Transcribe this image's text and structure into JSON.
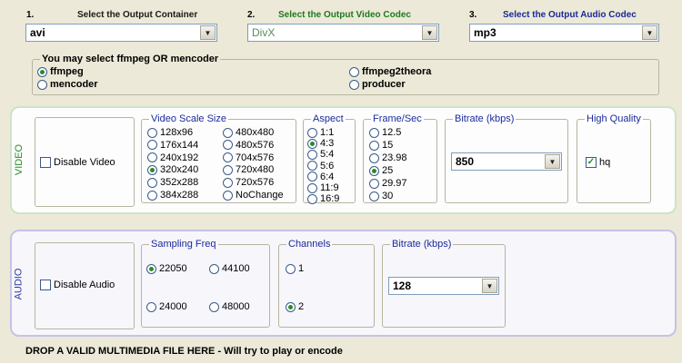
{
  "selectors": [
    {
      "num": "1.",
      "label": "Select the Output Container",
      "value": "avi"
    },
    {
      "num": "2.",
      "label": "Select the Output Video Codec",
      "value": "DivX"
    },
    {
      "num": "3.",
      "label": "Select the Output Audio Codec",
      "value": "mp3"
    }
  ],
  "encoder": {
    "title": "You may select ffmpeg OR mencoder",
    "options": [
      "ffmpeg",
      "mencoder",
      "ffmpeg2theora",
      "producer"
    ],
    "selected": "ffmpeg"
  },
  "video": {
    "panel_label": "VIDEO",
    "disable_label": "Disable Video",
    "scale": {
      "title": "Video Scale Size",
      "options": [
        "128x96",
        "176x144",
        "240x192",
        "320x240",
        "352x288",
        "384x288",
        "480x480",
        "480x576",
        "704x576",
        "720x480",
        "720x576",
        "NoChange"
      ],
      "selected": "320x240"
    },
    "aspect": {
      "title": "Aspect",
      "options": [
        "1:1",
        "4:3",
        "5:4",
        "5:6",
        "6:4",
        "11:9",
        "16:9"
      ],
      "selected": "4:3"
    },
    "framerate": {
      "title": "Frame/Sec",
      "options": [
        "12.5",
        "15",
        "23.98",
        "25",
        "29.97",
        "30"
      ],
      "selected": "25"
    },
    "bitrate": {
      "title": "Bitrate (kbps)",
      "value": "850"
    },
    "quality": {
      "title": "High Quality",
      "check_label": "hq",
      "checked": true
    }
  },
  "audio": {
    "panel_label": "AUDIO",
    "disable_label": "Disable Audio",
    "sampling": {
      "title": "Sampling Freq",
      "options": [
        "22050",
        "44100",
        "24000",
        "48000"
      ],
      "selected": "22050"
    },
    "channels": {
      "title": "Channels",
      "options": [
        "1",
        "2"
      ],
      "selected": "2"
    },
    "bitrate": {
      "title": "Bitrate (kbps)",
      "value": "128"
    }
  },
  "dropzone": "DROP A VALID MULTIMEDIA FILE HERE - Will try to play or encode",
  "colors": {
    "background": "#ece9d8",
    "video_accent": "#2a8a2a",
    "audio_accent": "#2a3aa0"
  }
}
